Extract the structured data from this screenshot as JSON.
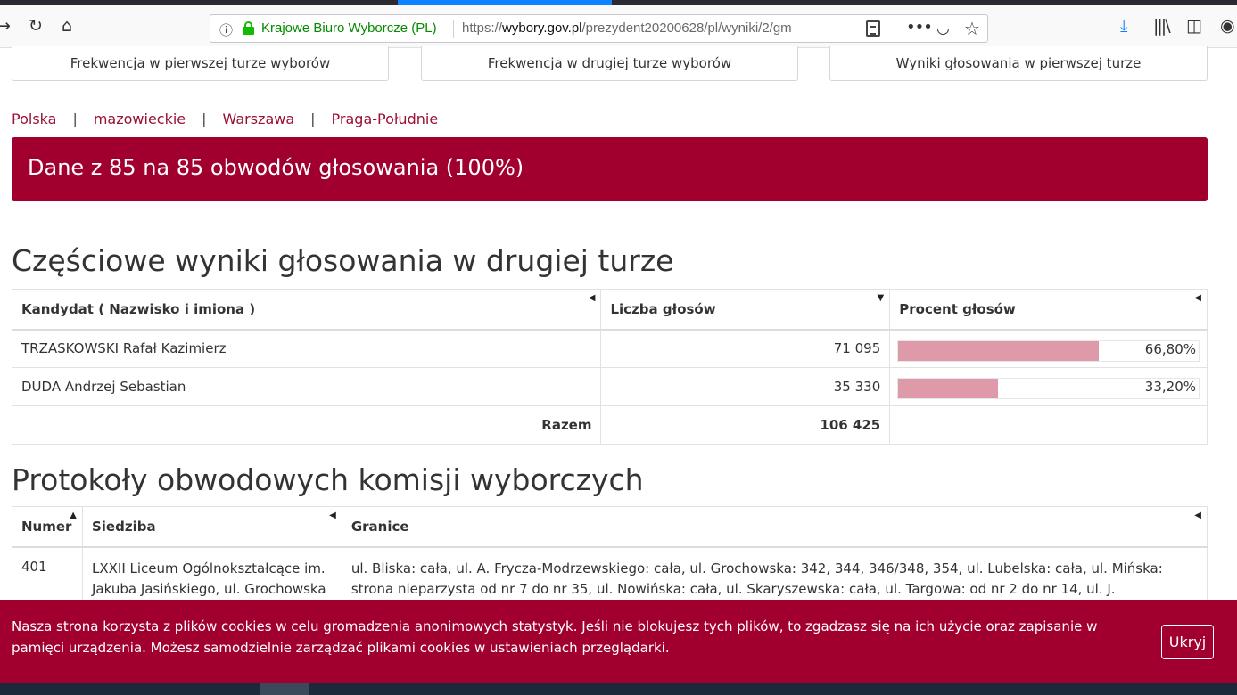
{
  "browser": {
    "site_identity": "Krajowe Biuro Wyborcze (PL)",
    "url_prefix": "https://",
    "url_host": "wybory.gov.pl",
    "url_path": "/prezydent20200628/pl/wyniki/2/gm",
    "icons": {
      "back": "arrow-left-icon",
      "reload": "reload-icon",
      "home": "home-icon",
      "info": "info-icon",
      "lock": "lock-icon",
      "reader": "reader-view-icon",
      "more": "more-icon",
      "pocket": "pocket-icon",
      "bookmark": "star-icon",
      "download": "download-icon",
      "library": "library-icon",
      "sidebar": "sidebar-icon",
      "account": "account-icon"
    }
  },
  "top_tabs": [
    {
      "label": "Frekwencja w pierwszej turze wyborów"
    },
    {
      "label": "Frekwencja w drugiej turze wyborów"
    },
    {
      "label": "Wyniki głosowania w pierwszej turze"
    }
  ],
  "breadcrumb": {
    "items": [
      "Polska",
      "mazowieckie",
      "Warszawa",
      "Praga-Południe"
    ],
    "separator": "|"
  },
  "banner": {
    "text": "Dane z 85 na 85 obwodów głosowania (100%)",
    "color": "#a1002f"
  },
  "results": {
    "title": "Częściowe wyniki głosowania w drugiej turze",
    "headers": {
      "candidate": "Kandydat ( Nazwisko i imiona )",
      "votes": "Liczba głosów",
      "percent": "Procent głosów"
    },
    "rows": [
      {
        "name": "TRZASKOWSKI Rafał Kazimierz",
        "votes": "71 095",
        "percent": "66,80%",
        "share": 0.668
      },
      {
        "name": "DUDA Andrzej Sebastian",
        "votes": "35 330",
        "percent": "33,20%",
        "share": 0.332
      }
    ],
    "total_label": "Razem",
    "total_votes": "106 425",
    "bar_color": "#de9aa8"
  },
  "protocols": {
    "title": "Protokoły obwodowych komisji wyborczych",
    "headers": {
      "number": "Numer",
      "seat": "Siedziba",
      "borders": "Granice"
    },
    "rows": [
      {
        "number": "401",
        "seat_line1": "LXXII Liceum Ogólnokształcące im.",
        "seat_line2": "Jakuba Jasińskiego, ul. Grochowska",
        "borders_line1": "ul. Bliska: cała, ul. A. Frycza-Modrzewskiego: cała, ul. Grochowska: 342, 344, 346/348, 354, ul. Lubelska: cała, ul. Mińska:",
        "borders_line2": "strona nieparzysta od nr 7 do nr 35, ul. Nowińska: cała, ul. Skaryszewska: cała, ul. Targowa: od nr 2 do nr 14, ul. J."
      }
    ]
  },
  "cookie": {
    "text": "Nasza strona korzysta z plików cookies w celu gromadzenia anonimowych statystyk. Jeśli nie blokujesz tych plików, to zgadzasz się na ich użycie oraz zapisanie w pamięci urządzenia. Możesz samodzielnie zarządzać plikami cookies w ustawieniach przeglądarki.",
    "button": "Ukryj"
  }
}
